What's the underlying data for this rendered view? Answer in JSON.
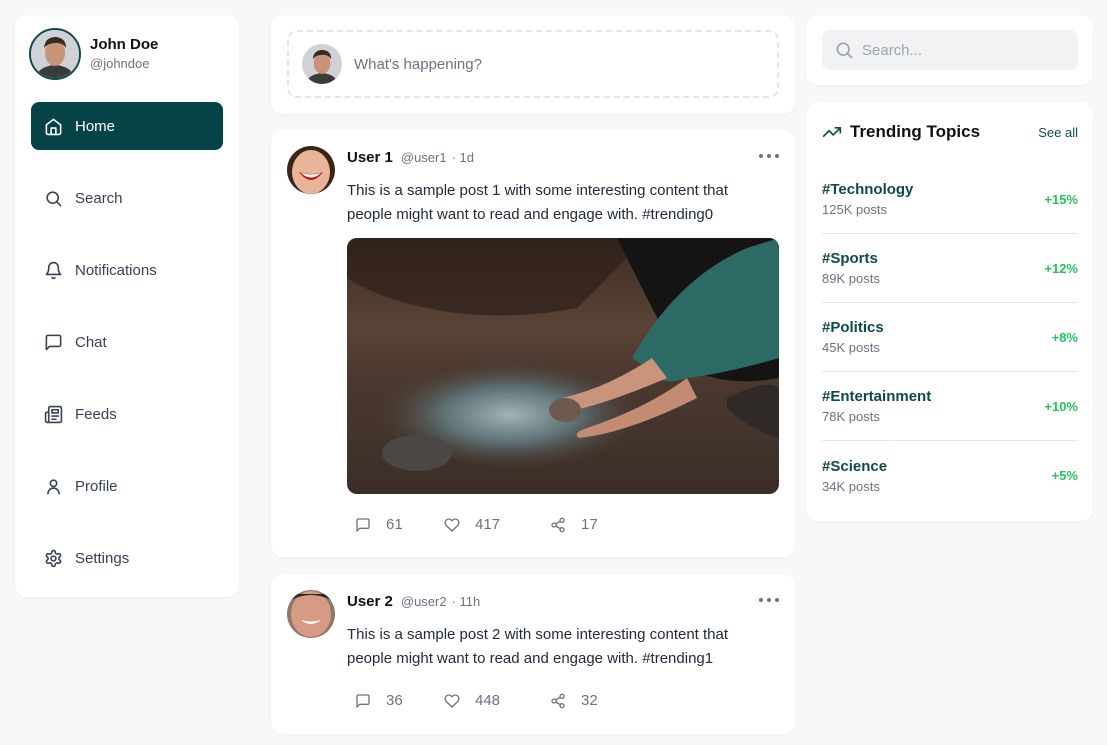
{
  "user": {
    "name": "John Doe",
    "handle": "@johndoe"
  },
  "nav": {
    "items": [
      {
        "label": "Home",
        "icon": "home-icon",
        "active": true
      },
      {
        "label": "Search",
        "icon": "search-icon"
      },
      {
        "label": "Notifications",
        "icon": "bell-icon"
      },
      {
        "label": "Chat",
        "icon": "message-icon"
      },
      {
        "label": "Feeds",
        "icon": "newspaper-icon"
      },
      {
        "label": "Profile",
        "icon": "user-icon"
      },
      {
        "label": "Settings",
        "icon": "gear-icon"
      }
    ]
  },
  "composer": {
    "placeholder": "What's happening?"
  },
  "posts": [
    {
      "user": "User 1",
      "handle": "@user1",
      "time": "· 1d",
      "body": "This is a sample post 1 with some interesting content that people might want to read and engage with. #trending0",
      "has_image": true,
      "comments": "61",
      "likes": "417",
      "shares": "17"
    },
    {
      "user": "User 2",
      "handle": "@user2",
      "time": "· 11h",
      "body": "This is a sample post 2 with some interesting content that people might want to read and engage with. #trending1",
      "has_image": false,
      "comments": "36",
      "likes": "448",
      "shares": "32"
    }
  ],
  "search": {
    "placeholder": "Search..."
  },
  "trending": {
    "title": "Trending Topics",
    "see_all": "See all",
    "items": [
      {
        "tag": "#Technology",
        "count": "125K posts",
        "change": "+15%"
      },
      {
        "tag": "#Sports",
        "count": "89K posts",
        "change": "+12%"
      },
      {
        "tag": "#Politics",
        "count": "45K posts",
        "change": "+8%"
      },
      {
        "tag": "#Entertainment",
        "count": "78K posts",
        "change": "+10%"
      },
      {
        "tag": "#Science",
        "count": "34K posts",
        "change": "+5%"
      }
    ]
  },
  "colors": {
    "accent": "#054346",
    "tag": "#0f4a4a",
    "positive": "#22c55e"
  }
}
